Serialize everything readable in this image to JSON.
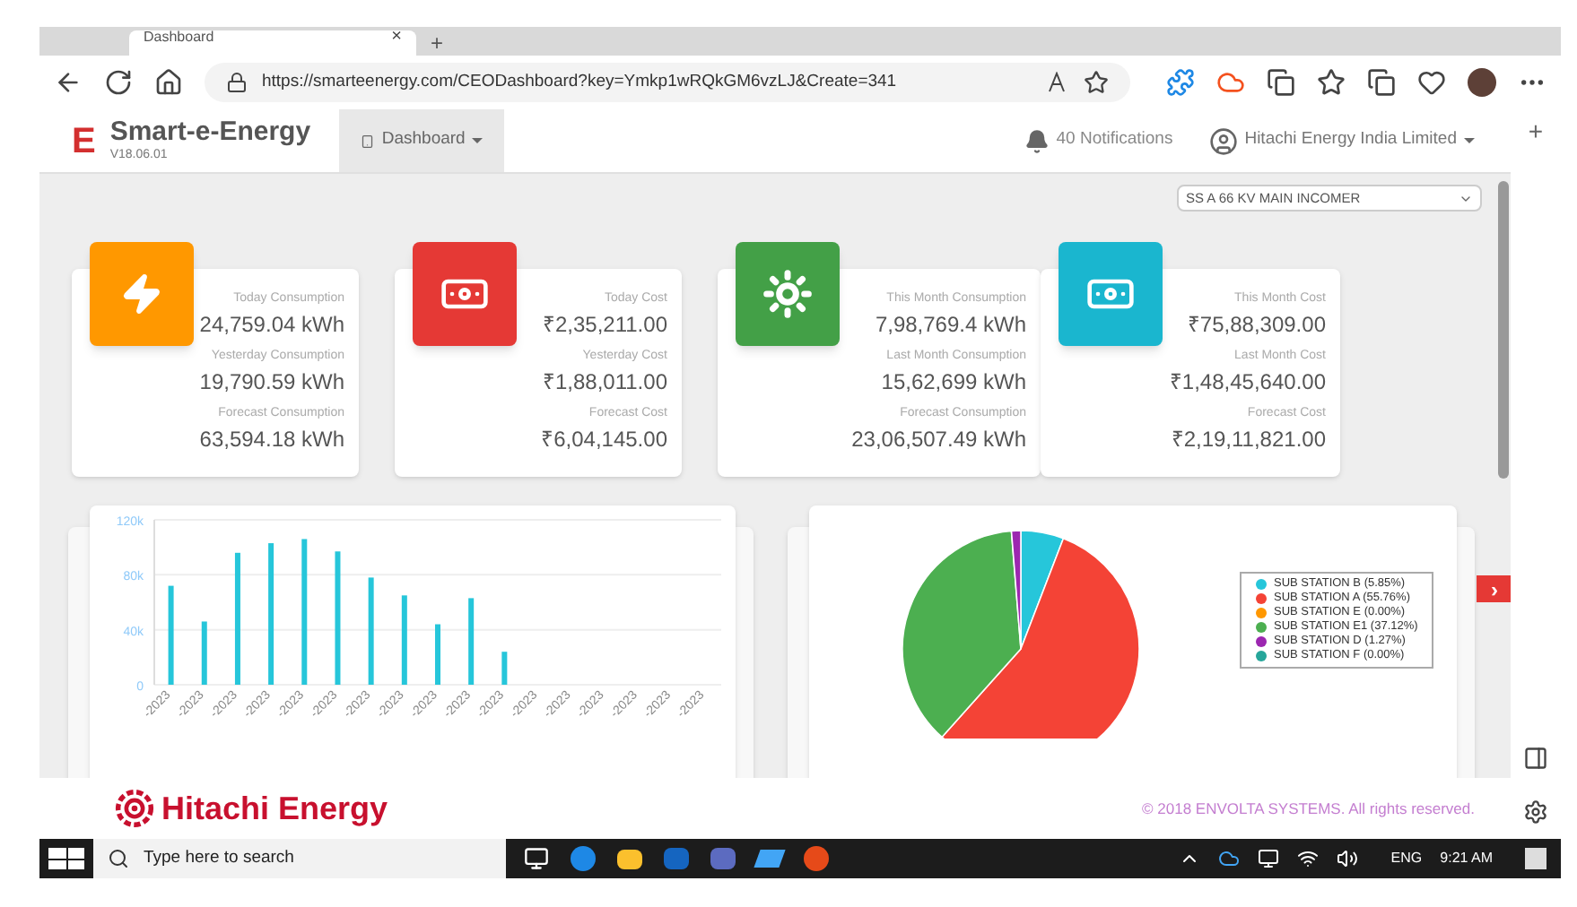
{
  "browser": {
    "tab": {
      "title": "Dashboard",
      "close": "×"
    },
    "new_tab": "+",
    "url": "https://smarteenergy.com/CEODashboard?key=Ymkp1wRQkGM6vzLJ&Create=341",
    "sidebar_add": "+"
  },
  "header": {
    "logo_letter": "E",
    "app_name": "Smart-e-Energy",
    "version": "V18.06.01",
    "menu": "Dashboard",
    "notifications": "40 Notifications",
    "account": "Hitachi Energy India Limited"
  },
  "meter_select": {
    "value": "SS A 66 KV MAIN INCOMER"
  },
  "cards": [
    {
      "kind": "bolt",
      "color": "#ff9800",
      "stats": [
        {
          "label": "Today Consumption",
          "value": "24,759.04 kWh"
        },
        {
          "label": "Yesterday Consumption",
          "value": "19,790.59 kWh"
        },
        {
          "label": "Forecast Consumption",
          "value": "63,594.18 kWh"
        }
      ]
    },
    {
      "kind": "cash",
      "color": "#e53935",
      "stats": [
        {
          "label": "Today Cost",
          "value": "₹2,35,211.00"
        },
        {
          "label": "Yesterday Cost",
          "value": "₹1,88,011.00"
        },
        {
          "label": "Forecast Cost",
          "value": "₹6,04,145.00"
        }
      ]
    },
    {
      "kind": "gear",
      "color": "#43a047",
      "stats": [
        {
          "label": "This Month Consumption",
          "value": "7,98,769.4 kWh"
        },
        {
          "label": "Last Month Consumption",
          "value": "15,62,699 kWh"
        },
        {
          "label": "Forecast Consumption",
          "value": "23,06,507.49 kWh"
        }
      ]
    },
    {
      "kind": "cash",
      "color": "#1ab6cf",
      "stats": [
        {
          "label": "This Month Cost",
          "value": "₹75,88,309.00"
        },
        {
          "label": "Last Month Cost",
          "value": "₹1,48,45,640.00"
        },
        {
          "label": "Forecast Cost",
          "value": "₹2,19,11,821.00"
        }
      ]
    }
  ],
  "bar_panel": {
    "chart_data": {
      "type": "bar",
      "categories": [
        "-2023",
        "-2023",
        "-2023",
        "-2023",
        "-2023",
        "-2023",
        "-2023",
        "-2023",
        "-2023",
        "-2023",
        "-2023",
        "-2023",
        "-2023",
        "-2023",
        "-2023",
        "-2023",
        "-2023"
      ],
      "series": [
        {
          "color": "#26c6da",
          "values": [
            72000,
            46000,
            96000,
            103000,
            106000,
            97000,
            78000,
            65000,
            44000,
            63000,
            24000,
            0,
            0,
            0,
            0,
            0,
            0
          ]
        }
      ],
      "ylim": [
        0,
        120000
      ],
      "yticks": [
        {
          "value": 0,
          "label": "0"
        },
        {
          "value": 40000,
          "label": "40k"
        },
        {
          "value": 80000,
          "label": "80k"
        },
        {
          "value": 120000,
          "label": "120k"
        }
      ]
    }
  },
  "next_button": "›",
  "pie_panel": {
    "chart_data": {
      "type": "pie",
      "categories": [
        "SUB STATION B (5.85%)",
        "SUB STATION A (55.76%)",
        "SUB STATION E (0.00%)",
        "SUB STATION E1 (37.12%)",
        "SUB STATION D (1.27%)",
        "SUB STATION F (0.00%)"
      ],
      "series": [
        {
          "values": [
            5.85,
            55.76,
            0,
            37.12,
            1.27,
            0
          ]
        }
      ]
    },
    "legend": [
      {
        "color": "#26c6da"
      },
      {
        "color": "#f44336"
      },
      {
        "color": "#ff9800"
      },
      {
        "color": "#4caf50"
      },
      {
        "color": "#9c27b0"
      },
      {
        "color": "#26a69a"
      }
    ]
  },
  "footer": {
    "brand": "Hitachi Energy",
    "copyright": "© 2018 ENVOLTA SYSTEMS. All rights reserved."
  },
  "taskbar": {
    "search_placeholder": "Type here to search",
    "language": "ENG",
    "time": "9:21 AM"
  }
}
